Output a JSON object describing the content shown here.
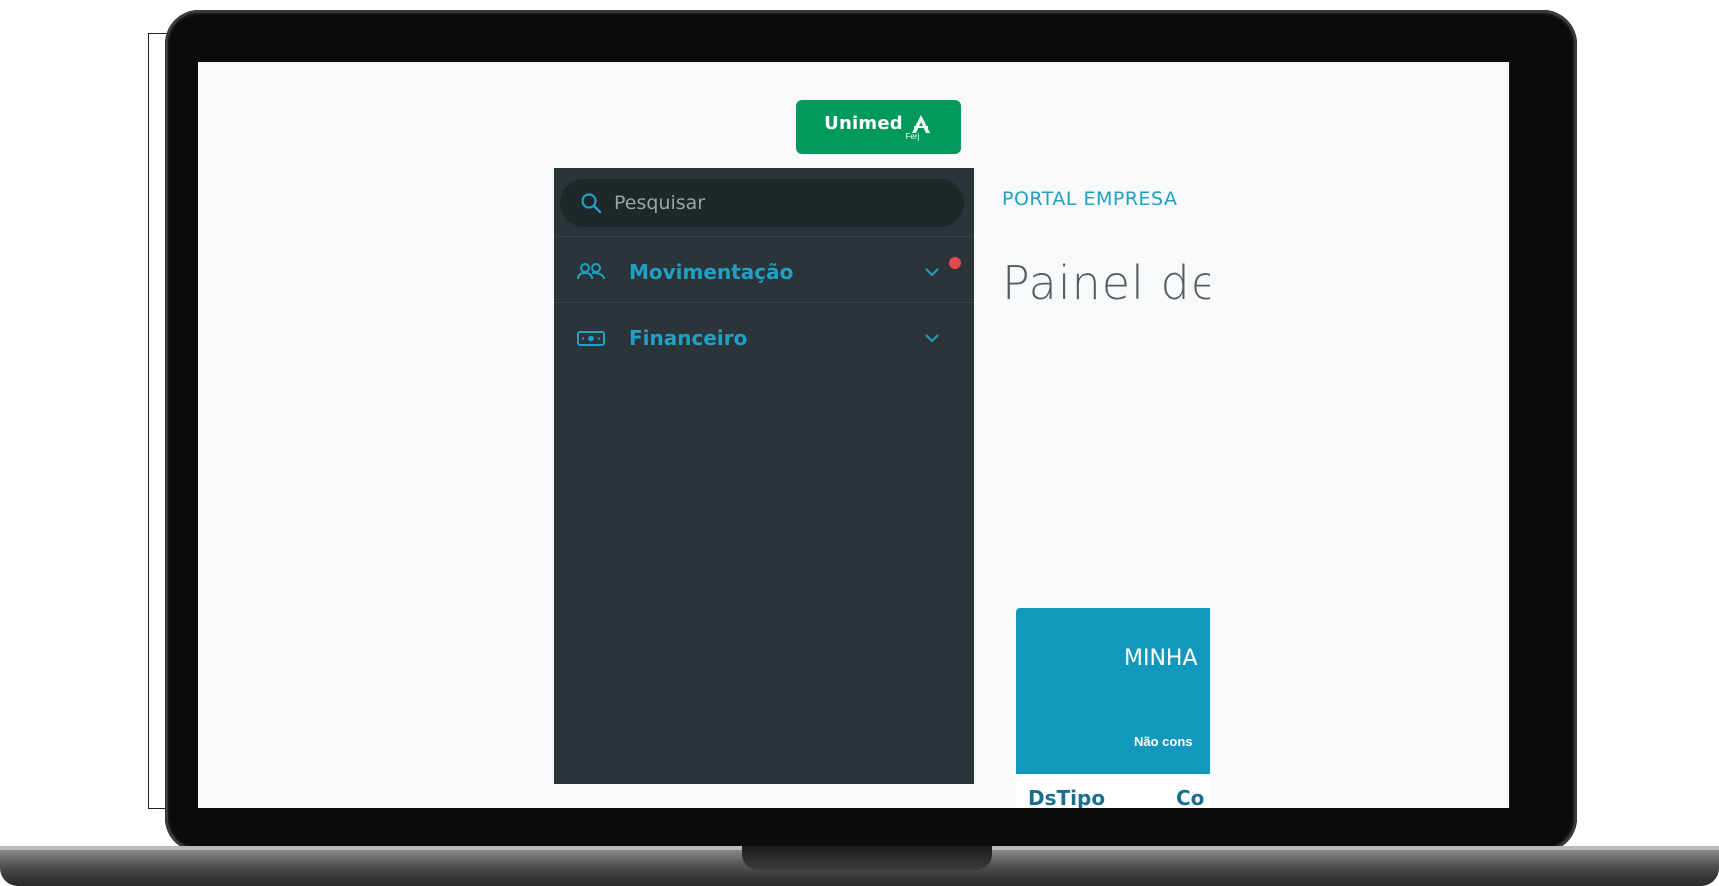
{
  "header": {
    "logo": {
      "name": "Unimed",
      "sub": "Ferj"
    }
  },
  "sidebar": {
    "search_placeholder": "Pesquisar",
    "items": [
      {
        "label": "Movimentação",
        "icon": "users-icon",
        "has_notification": true
      },
      {
        "label": "Financeiro",
        "icon": "money-icon",
        "has_notification": false
      }
    ]
  },
  "main": {
    "breadcrumb": "PORTAL EMPRESA",
    "page_title": "Painel de",
    "card": {
      "title": "MINHA",
      "subtitle": "Não cons"
    },
    "table_headers": [
      "DsTipo",
      "Co"
    ]
  },
  "colors": {
    "accent": "#1fa0c4",
    "sidebar_bg": "#2b3539",
    "brand_green": "#00995d",
    "card_bg": "#1398bd",
    "notification": "#e5484d"
  }
}
